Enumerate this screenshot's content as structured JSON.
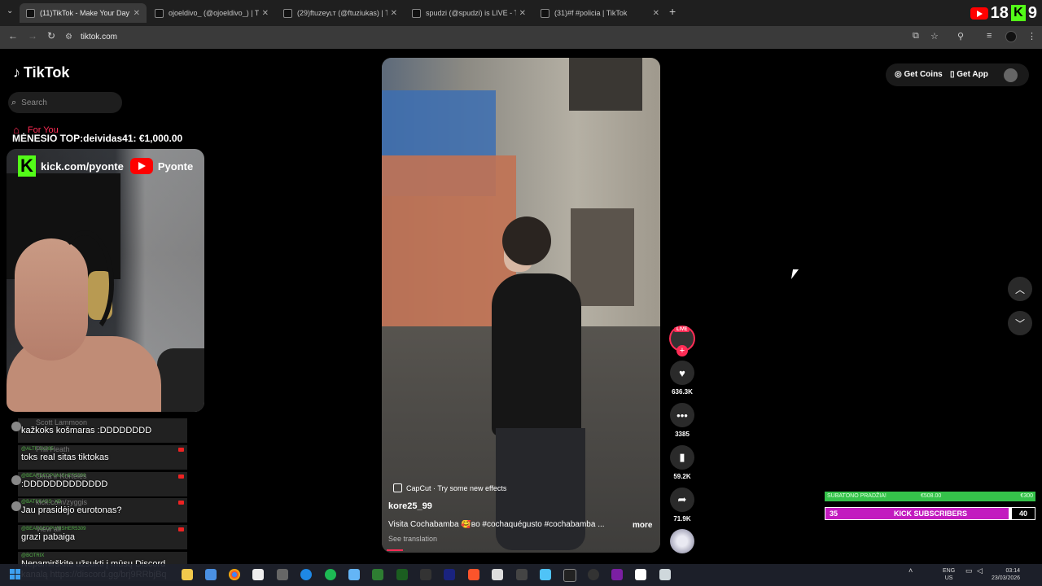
{
  "browser": {
    "tabs": [
      {
        "title": "(11)TikTok - Make Your Day",
        "active": true
      },
      {
        "title": "ojoeldivo_ (@ojoeldivo_) | TikTo",
        "active": false
      },
      {
        "title": "(29)ftuzeyʟт (@ftuziukas) | TikTo",
        "active": false
      },
      {
        "title": "spudzi (@spudzi) is LIVE - TikTo",
        "active": false
      },
      {
        "title": "(31)#f #policia | TikTok",
        "active": false
      }
    ],
    "url": "tiktok.com",
    "overlay_numbers": [
      "18",
      "9"
    ]
  },
  "tiktok": {
    "logo": "TikTok",
    "search_placeholder": "Search",
    "nav_for_you": "For You",
    "get_coins": "Get Coins",
    "get_app": "Get App",
    "video": {
      "effect_label": "CapCut · Try some new effects",
      "author": "kore25_99",
      "description": "Visita Cochabamba 🥰ʙᴏ #cochaquégusto #cochabamba ...",
      "more": "more",
      "see_translation": "See translation"
    },
    "actions": {
      "live_tag": "LIVE",
      "likes": "636.3K",
      "comments": "3385",
      "saves": "59.2K",
      "shares": "71.9K"
    }
  },
  "stream_overlay": {
    "top_donor": "MĖNESIO TOP:deividas41: €1,000.00",
    "kick_url": "kick.com/pyonte",
    "youtube_name": "Pyonte",
    "chat": [
      {
        "user": "",
        "ghost": "Scott Lammoon",
        "text": "kažkoks košmaras :DDDDDDDD"
      },
      {
        "user": "@ALTF-5X985",
        "ghost": "Phil Heath",
        "text": "toks real sitas tiktokas"
      },
      {
        "user": "@BEARDEDPUNISHER5309",
        "ghost": "Oma ir Kortelės",
        "text": ":DDDDDDDDDDDDD"
      },
      {
        "user": "@BATUKASS_XD",
        "ghost": "kick.com/zyggis",
        "text": "Jau prasidėjo eurotonas?"
      },
      {
        "user": "@BEARDEDPUNISHER5309",
        "ghost": "View all",
        "text": "grazi pabaiga"
      },
      {
        "user": "@BOTRIX",
        "ghost": "",
        "text": "Nepamirškite užsukti į mūsų Discord kanalą https://discord.gg/brj9RRbjBq"
      }
    ],
    "goal_bar_1": {
      "left": "SUBATONO PRADŽIA!",
      "middle": "€508.00",
      "right": "€300"
    },
    "goal_bar_2": {
      "left": "35",
      "label": "KICK SUBSCRIBERS",
      "right": "40",
      "progress": 0.875
    }
  },
  "taskbar": {
    "lang": "ENG",
    "region": "US",
    "time": "03:14",
    "date": "23/03/2026"
  },
  "colors": {
    "tiktok_red": "#fe2c55",
    "kick_green": "#53fc18",
    "youtube_red": "#ff0000",
    "goal_green": "#35c24a",
    "goal_magenta": "#c21bbf"
  }
}
